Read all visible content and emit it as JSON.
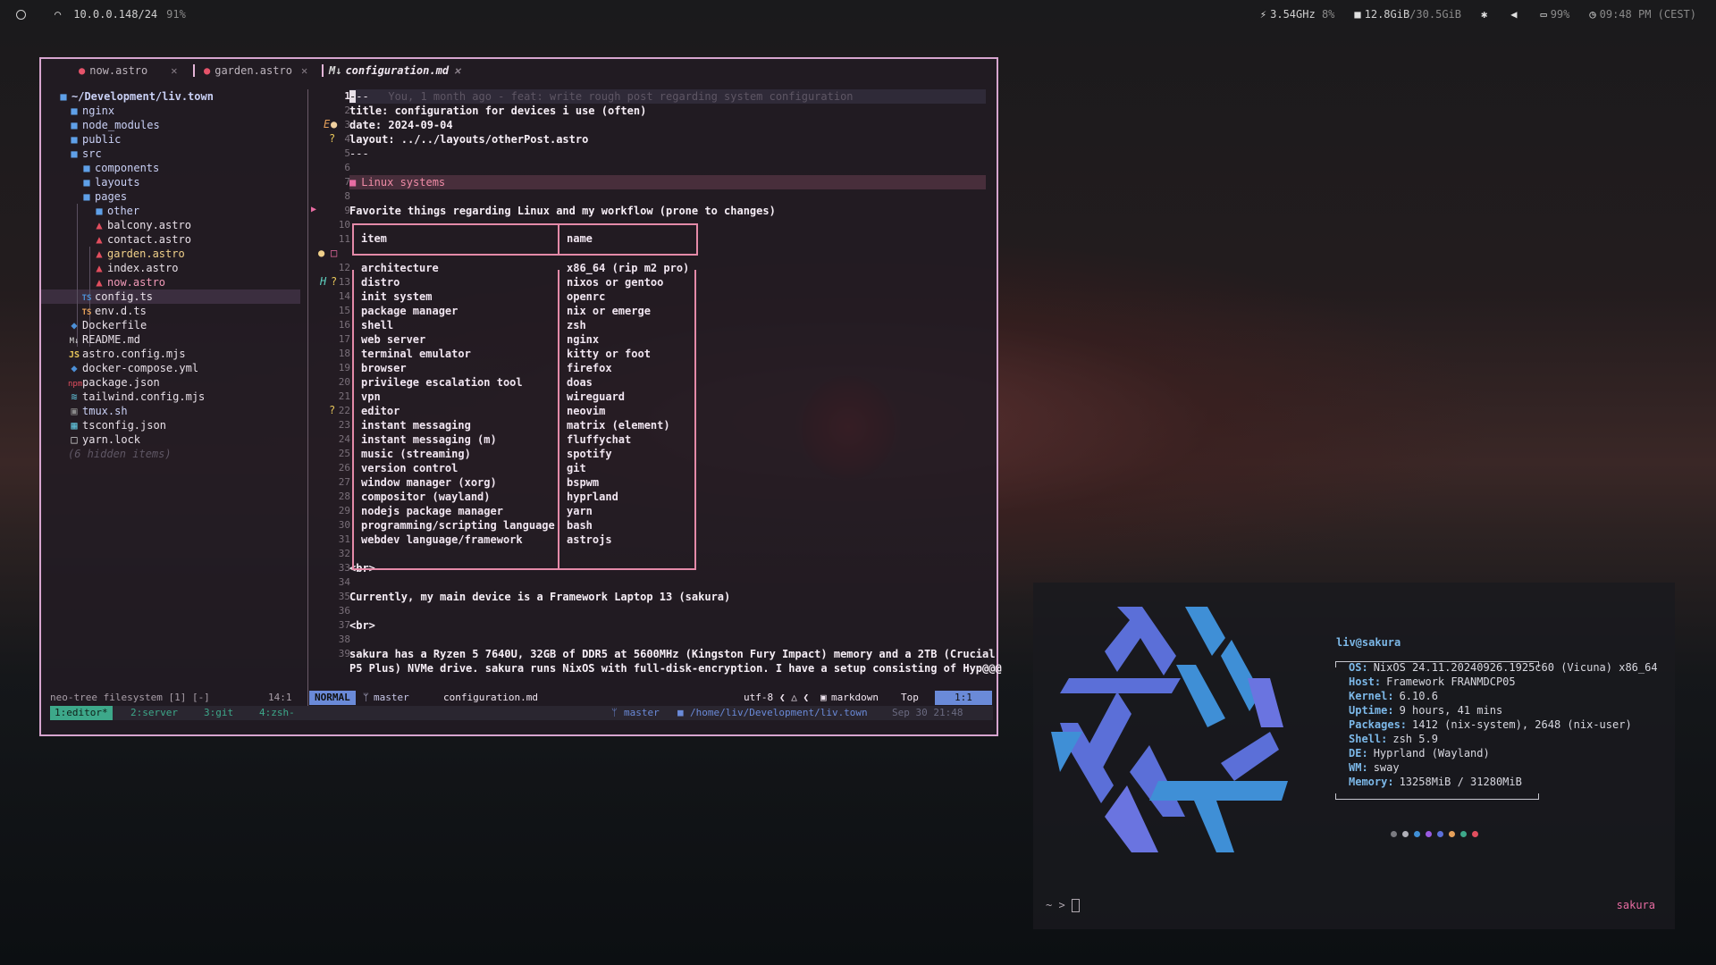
{
  "topbar": {
    "network": "10.0.0.148/24",
    "wifi_strength": "91%",
    "cpu_freq": "3.54GHz",
    "cpu_usage": "8%",
    "mem_used": "12.8GiB",
    "mem_total": "/30.5GiB",
    "battery": "99%",
    "clock": "09:48 PM (CEST)"
  },
  "tabs": [
    {
      "label": "now.astro"
    },
    {
      "label": "garden.astro"
    },
    {
      "label": "configuration.md"
    }
  ],
  "tree": {
    "root": "~/Development/liv.town",
    "items": [
      "nginx",
      "node_modules",
      "public",
      "src",
      "components",
      "layouts",
      "pages",
      "other",
      "balcony.astro",
      "contact.astro",
      "garden.astro",
      "index.astro",
      "now.astro",
      "config.ts",
      "env.d.ts",
      "Dockerfile",
      "README.md",
      "astro.config.mjs",
      "docker-compose.yml",
      "package.json",
      "tailwind.config.mjs",
      "tmux.sh",
      "tsconfig.json",
      "yarn.lock"
    ],
    "hidden": "(6 hidden items)",
    "git_e": "E",
    "git_q": "?",
    "git_h": "H"
  },
  "editor": {
    "blame": "You, 1 month ago - feat: write rough post regarding system configuration",
    "front_title": "title: configuration for devices i use (often)",
    "front_date": "date: 2024-09-04",
    "front_layout": "layout: ../../layouts/otherPost.astro",
    "dashes": "---",
    "heading": "Linux systems",
    "intro": "Favorite things regarding Linux and my workflow (prone to changes)",
    "table_head": {
      "item": "item",
      "name": "name"
    },
    "table_rows": [
      [
        "architecture",
        "x86_64 (rip m2 pro)"
      ],
      [
        "distro",
        "nixos or gentoo"
      ],
      [
        "init system",
        "openrc"
      ],
      [
        "package manager",
        "nix or emerge"
      ],
      [
        "shell",
        "zsh"
      ],
      [
        "web server",
        "nginx"
      ],
      [
        "terminal emulator",
        "kitty or foot"
      ],
      [
        "browser",
        "firefox"
      ],
      [
        "privilege escalation tool",
        "doas"
      ],
      [
        "vpn",
        "wireguard"
      ],
      [
        "editor",
        "neovim"
      ],
      [
        "instant messaging",
        "matrix (element)"
      ],
      [
        "instant messaging (m)",
        "fluffychat"
      ],
      [
        "music (streaming)",
        "spotify"
      ],
      [
        "version control",
        "git"
      ],
      [
        "window manager (xorg)",
        "bspwm"
      ],
      [
        "compositor (wayland)",
        "hyprland"
      ],
      [
        "nodejs package manager",
        "yarn"
      ],
      [
        "programming/scripting language",
        "bash"
      ],
      [
        "webdev language/framework",
        "astrojs"
      ]
    ],
    "br": "<br>",
    "main_device": "Currently, my main device is a Framework Laptop 13 (sakura)",
    "line39a": "sakura has a Ryzen 5 7640U, 32GB of DDR5 at 5600MHz (Kingston Fury Impact) memory and a 2TB (Crucial",
    "line39b": "P5 Plus) NVMe drive. sakura runs NixOS with full-disk-encryption. I have a setup consisting of Hyp@@@"
  },
  "status": {
    "left": "neo-tree filesystem [1] [-]",
    "pos": "14:1",
    "mode": "NORMAL",
    "branch": "master",
    "file": "configuration.md",
    "encoding": "utf-8",
    "filetype": "markdown",
    "top": "Top",
    "cursor": "1:1"
  },
  "tmux": {
    "w1": "1:editor*",
    "w2": "2:server",
    "w3": "3:git",
    "w4": "4:zsh-",
    "branch": "master",
    "path": "/home/liv/Development/liv.town",
    "date": "Sep 30 21:48"
  },
  "fastfetch": {
    "title": "liv@sakura",
    "rows": [
      {
        "k": "OS:",
        "v": "NixOS 24.11.20240926.1925c60 (Vicuna) x86_64"
      },
      {
        "k": "Host:",
        "v": "Framework FRANMDCP05"
      },
      {
        "k": "Kernel:",
        "v": "6.10.6"
      },
      {
        "k": "Uptime:",
        "v": "9 hours, 41 mins"
      },
      {
        "k": "Packages:",
        "v": "1412 (nix-system), 2648 (nix-user)"
      },
      {
        "k": "Shell:",
        "v": "zsh 5.9"
      },
      {
        "k": "DE:",
        "v": "Hyprland (Wayland)"
      },
      {
        "k": "WM:",
        "v": "sway"
      },
      {
        "k": "Memory:",
        "v": "13258MiB / 31280MiB"
      }
    ],
    "prompt": "~ >",
    "hostname": "sakura"
  },
  "colors": {
    "accent": "#d7a5cf",
    "nix_blue": "#5b7bdc",
    "nix_light": "#7ab6e8"
  }
}
